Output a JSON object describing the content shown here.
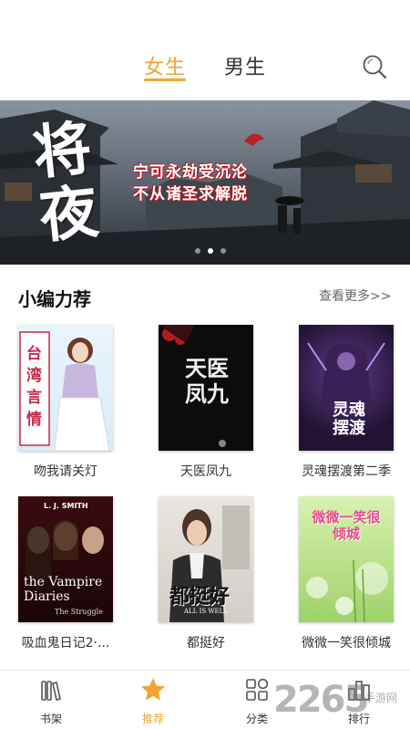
{
  "header": {
    "tabs": [
      {
        "label": "女生",
        "active": true
      },
      {
        "label": "男生",
        "active": false
      }
    ],
    "search_icon": "search-icon",
    "accent_color": "#f0a531"
  },
  "banner": {
    "title": "将夜",
    "line1": "宁可永劫受沉沦",
    "line2": "不从诸圣求解脱",
    "dot_count": 3,
    "active_dot": 1
  },
  "section": {
    "title": "小编力荐",
    "more_label": "查看更多>>"
  },
  "books": [
    {
      "title": "吻我请关灯",
      "cover_text": "台湾言情"
    },
    {
      "title": "天医凤九",
      "cover_text": "天医凤九"
    },
    {
      "title": "灵魂摆渡第二季",
      "cover_text": "灵魂摆渡"
    },
    {
      "title": "吸血鬼日记2·...",
      "cover_author": "L. J. SMITH",
      "cover_text": "the Vampire Diaries",
      "cover_sub": "The Struggle"
    },
    {
      "title": "都挺好",
      "cover_text": "都挺好",
      "cover_sub": "ALL IS WELL"
    },
    {
      "title": "微微一笑很倾城",
      "cover_text": "微微一笑很倾城"
    }
  ],
  "bottom_nav": [
    {
      "label": "书架",
      "icon": "bookshelf-icon",
      "active": false
    },
    {
      "label": "推荐",
      "icon": "star-icon",
      "active": true
    },
    {
      "label": "分类",
      "icon": "category-grid-icon",
      "active": false
    },
    {
      "label": "排行",
      "icon": "ranking-icon",
      "active": false
    }
  ],
  "watermark": {
    "number": "2265",
    "text": "手游网"
  }
}
